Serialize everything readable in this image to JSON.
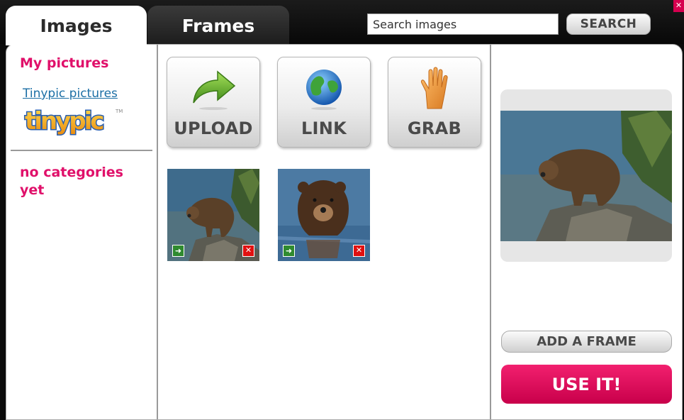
{
  "tabs": [
    {
      "label": "Images",
      "active": true
    },
    {
      "label": "Frames",
      "active": false
    }
  ],
  "search": {
    "placeholder": "Search images",
    "value": "",
    "button_label": "SEARCH"
  },
  "close_icon": "close-icon",
  "sidebar": {
    "my_pictures_title": "My pictures",
    "tinypic_link": "Tinypic pictures",
    "tinypic_logo": {
      "text": "tinypic",
      "tm": "TM"
    },
    "categories_empty": "no categories yet"
  },
  "actions": [
    {
      "label": "UPLOAD",
      "icon": "arrow-right-icon"
    },
    {
      "label": "LINK",
      "icon": "globe-icon"
    },
    {
      "label": "GRAB",
      "icon": "hand-icon"
    }
  ],
  "thumbnails": [
    {
      "subject": "bear on rocks",
      "use_icon": "arrow-icon",
      "delete_icon": "delete-icon"
    },
    {
      "subject": "bear in water",
      "use_icon": "arrow-icon",
      "delete_icon": "delete-icon"
    }
  ],
  "preview": {
    "subject": "bear on rocks"
  },
  "buttons": {
    "add_frame": "ADD A FRAME",
    "use_it": "USE IT!"
  },
  "colors": {
    "accent": "#e0106a",
    "link": "#1c6fa5",
    "use_it": "#d9005a",
    "background": "#0b0b0b"
  }
}
